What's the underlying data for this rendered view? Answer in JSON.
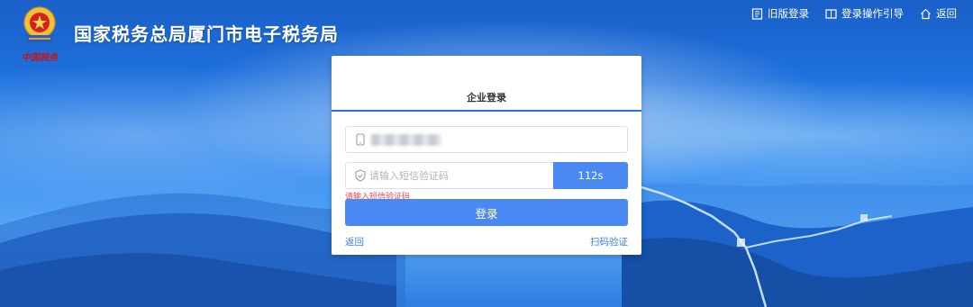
{
  "header": {
    "title": "国家税务总局厦门市电子税务局",
    "brand_script": "中国税务",
    "links": [
      {
        "icon": "document-icon",
        "label": "旧版登录"
      },
      {
        "icon": "book-icon",
        "label": "登录操作引导"
      },
      {
        "icon": "home-icon",
        "label": "返回"
      }
    ]
  },
  "login": {
    "tab_label": "企业登录",
    "code_placeholder": "请输入短信验证码",
    "code_value": "",
    "timer_label": "112s",
    "error_message": "请输入短信验证码",
    "submit_label": "登录",
    "back_link": "返回",
    "qr_link": "扫码验证"
  },
  "colors": {
    "accent": "#4a89f3",
    "tab_underline": "#2f6ed8",
    "error": "#e8474c",
    "link": "#3f7fe8"
  }
}
